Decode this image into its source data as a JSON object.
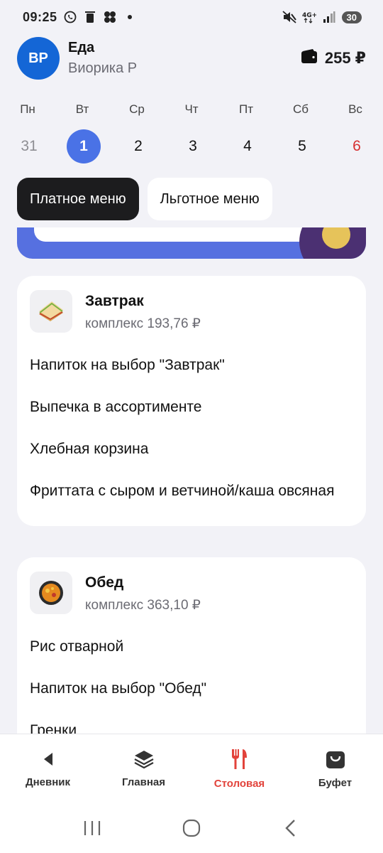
{
  "status_bar": {
    "time": "09:25",
    "left_icons": [
      "whatsapp-icon",
      "trash-icon",
      "clover-icon",
      "dot-icon"
    ],
    "right_icons": [
      "mute-icon",
      "4g-icon",
      "signal-icon"
    ],
    "battery": "30"
  },
  "header": {
    "avatar_initials": "ВР",
    "title": "Еда",
    "subtitle": "Виорика Р",
    "balance": "255 ₽",
    "balance_icon": "wallet-icon"
  },
  "week": {
    "days_of_week": [
      "Пн",
      "Вт",
      "Ср",
      "Чт",
      "Пт",
      "Сб",
      "Вс"
    ],
    "dates": [
      "31",
      "1",
      "2",
      "3",
      "4",
      "5",
      "6"
    ],
    "selected_index": 1
  },
  "tabs": [
    {
      "label": "Платное меню",
      "active": true
    },
    {
      "label": "Льготное меню",
      "active": false
    }
  ],
  "meals": [
    {
      "title": "Завтрак",
      "price": "комплекс 193,76 ₽",
      "icon": "sandwich-icon",
      "items": [
        "Напиток на выбор \"Завтрак\"",
        "Выпечка в ассортименте",
        "Хлебная корзина",
        "Фриттата с сыром и ветчиной/каша овсяная"
      ]
    },
    {
      "title": "Обед",
      "price": "комплекс 363,10 ₽",
      "icon": "pan-dish-icon",
      "items": [
        "Рис отварной",
        "Напиток на выбор \"Обед\"",
        "Гренки"
      ]
    }
  ],
  "bottom_nav": [
    {
      "label": "Дневник",
      "icon": "play-left-icon",
      "active": false
    },
    {
      "label": "Главная",
      "icon": "layers-icon",
      "active": false
    },
    {
      "label": "Столовая",
      "icon": "fork-knife-icon",
      "active": true
    },
    {
      "label": "Буфет",
      "icon": "shopping-bag-icon",
      "active": false
    }
  ],
  "colors": {
    "background": "#f2f2f7",
    "accent_blue": "#4a72e6",
    "avatar_blue": "#1466d6",
    "active_red": "#e2433b",
    "sunday_red": "#d63031",
    "tab_active": "#1c1c1e"
  }
}
